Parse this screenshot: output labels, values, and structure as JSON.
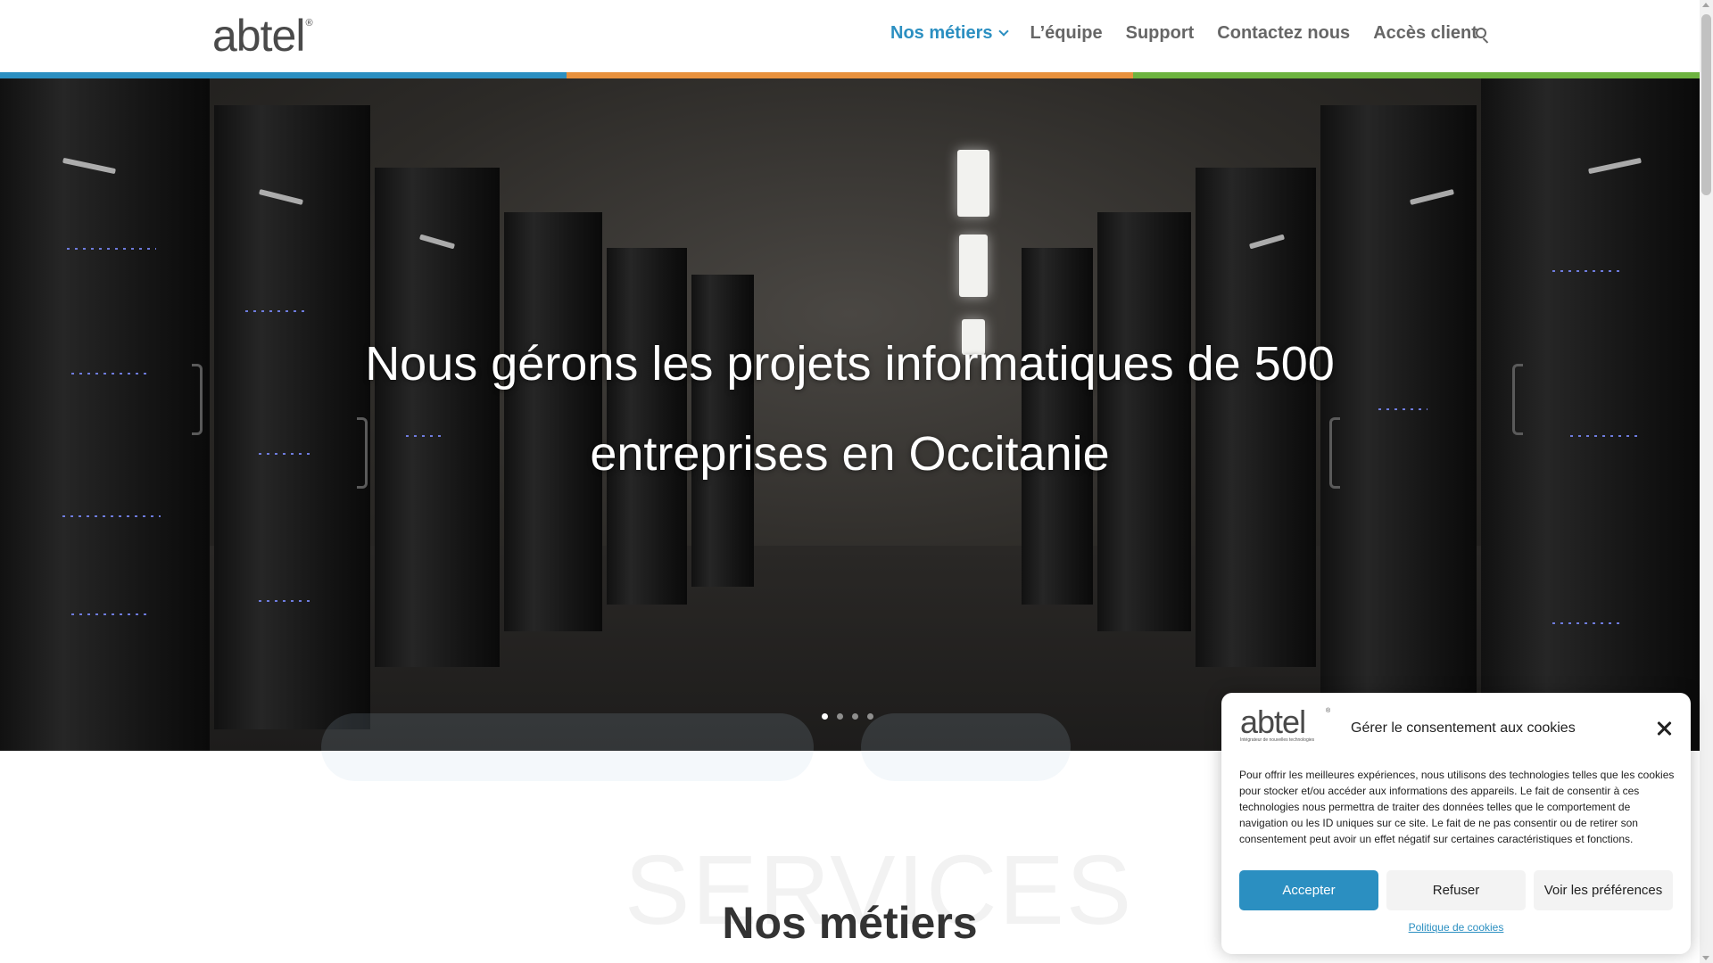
{
  "brand": {
    "logo_text": "abtel",
    "logo_reg": "®"
  },
  "nav": {
    "items": [
      {
        "label": "Nos métiers"
      },
      {
        "label": "L’équipe"
      },
      {
        "label": "Support"
      },
      {
        "label": "Contactez nous"
      },
      {
        "label": "Accès client"
      }
    ],
    "search_icon": "search-icon"
  },
  "colors": {
    "accent": "#2b8fc1",
    "stripe": [
      "#2b8fc1",
      "#e8913d",
      "#6db33f"
    ]
  },
  "hero": {
    "title_line1": "Nous gérons les projets informatiques de 500",
    "title_line2": "entreprises en Occitanie",
    "slide_count": 4,
    "active_slide": 1
  },
  "section": {
    "ghost_text": "SERVICES",
    "title": "Nos métiers"
  },
  "cookie": {
    "logo_text": "abtel",
    "logo_reg": "®",
    "logo_subtitle": "Intégrateur de nouvelles technologies",
    "title": "Gérer le consentement aux cookies",
    "body": "Pour offrir les meilleures expériences, nous utilisons des technologies telles que les cookies pour stocker et/ou accéder aux informations des appareils. Le fait de consentir à ces technologies nous permettra de traiter des données telles que le comportement de navigation ou les ID uniques sur ce site. Le fait de ne pas consentir ou de retirer son consentement peut avoir un effet négatif sur certaines caractéristiques et fonctions.",
    "accept_label": "Accepter",
    "refuse_label": "Refuser",
    "prefs_label": "Voir les préférences",
    "policy_label": "Politique de cookies"
  }
}
